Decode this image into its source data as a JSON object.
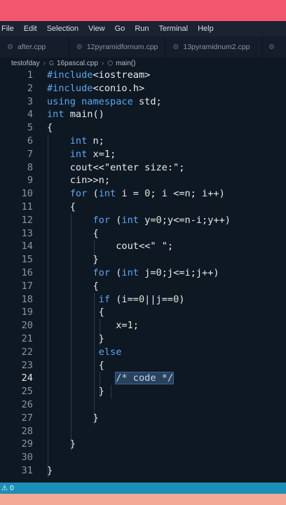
{
  "menu": [
    "File",
    "Edit",
    "Selection",
    "View",
    "Go",
    "Run",
    "Terminal",
    "Help"
  ],
  "tabs": [
    "after.cpp",
    "12pyramidfornum.cpp",
    "13pyramidnum2.cpp"
  ],
  "breadcrumb": {
    "folder": "testofday",
    "file": "16pascal.cpp",
    "symbol": "main()"
  },
  "code_lines": [
    {
      "n": "1",
      "t": "#include<iostream>"
    },
    {
      "n": "2",
      "t": "#include<conio.h>"
    },
    {
      "n": "3",
      "t": "using namespace std;"
    },
    {
      "n": "4",
      "t": "int main()"
    },
    {
      "n": "5",
      "t": "{"
    },
    {
      "n": "6",
      "t": "    int n;"
    },
    {
      "n": "7",
      "t": "    int x=1;"
    },
    {
      "n": "8",
      "t": "    cout<<\"enter size:\";"
    },
    {
      "n": "9",
      "t": "    cin>>n;"
    },
    {
      "n": "10",
      "t": "    for (int i = 0; i <=n; i++)"
    },
    {
      "n": "11",
      "t": "    {"
    },
    {
      "n": "12",
      "t": "        for (int y=0;y<=n-i;y++)"
    },
    {
      "n": "13",
      "t": "        {"
    },
    {
      "n": "14",
      "t": "            cout<<\" \";"
    },
    {
      "n": "15",
      "t": "        }"
    },
    {
      "n": "16",
      "t": "        for (int j=0;j<=i;j++)"
    },
    {
      "n": "17",
      "t": "        {"
    },
    {
      "n": "18",
      "t": "         if (i==0||j==0)"
    },
    {
      "n": "19",
      "t": "         {"
    },
    {
      "n": "20",
      "t": "            x=1;"
    },
    {
      "n": "21",
      "t": "         }"
    },
    {
      "n": "22",
      "t": "         else"
    },
    {
      "n": "23",
      "t": "         {"
    },
    {
      "n": "24",
      "t": "            /* code */"
    },
    {
      "n": "25",
      "t": "         }"
    },
    {
      "n": "26",
      "t": ""
    },
    {
      "n": "27",
      "t": "        }"
    },
    {
      "n": "28",
      "t": ""
    },
    {
      "n": "29",
      "t": "    }"
    },
    {
      "n": "30",
      "t": ""
    },
    {
      "n": "31",
      "t": "}"
    }
  ],
  "status": {
    "problems": "0"
  },
  "colors": {
    "top_band": "#f2566f",
    "bottom_band": "#f3a995",
    "editor_bg": "#0e1823",
    "keyword": "#5aa7f2",
    "status_bar": "#1b8fb8"
  }
}
